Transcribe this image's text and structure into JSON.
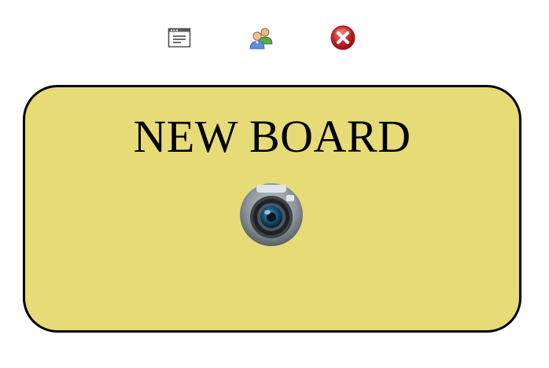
{
  "toolbar": {
    "items": [
      {
        "icon": "window-icon"
      },
      {
        "icon": "users-icon"
      },
      {
        "icon": "close-icon"
      }
    ]
  },
  "board": {
    "title": "NEW BOARD",
    "background_color": "#e7db78",
    "border_color": "#000000",
    "action_icon": "camera-icon"
  }
}
